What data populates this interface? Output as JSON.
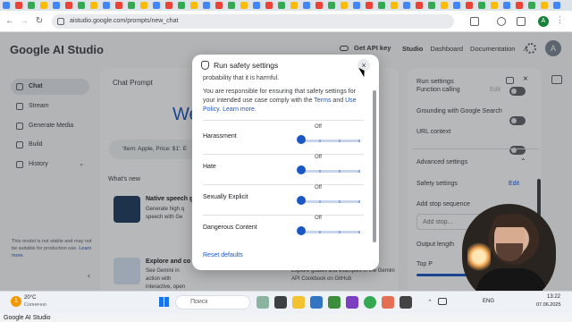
{
  "browser": {
    "url": "aistudio.google.com/prompts/new_chat",
    "avatar_letter": "A"
  },
  "app": {
    "brand": "Google AI Studio",
    "get_api_key": "Get API key",
    "top_nav": [
      "Studio",
      "Dashboard",
      "Documentation"
    ],
    "user_initial": "A"
  },
  "sidebar": {
    "items": [
      {
        "label": "Chat",
        "icon": "chat-icon"
      },
      {
        "label": "Stream",
        "icon": "stream-icon"
      },
      {
        "label": "Generate Media",
        "icon": "media-icon"
      },
      {
        "label": "Build",
        "icon": "build-icon"
      },
      {
        "label": "History",
        "icon": "history-icon"
      }
    ],
    "disclaimer": "This model is not stable and may not be suitable for production use.",
    "learn_more": "Learn more."
  },
  "main": {
    "title": "Chat Prompt",
    "welcome_partial": "We",
    "prompt_partial": "'Item: Apple, Price: $1'. E",
    "whats_new": "What's new",
    "cards": [
      {
        "title": "Native speech g",
        "desc": "Generate high q speech with Ge"
      },
      {
        "title": "Explore and co",
        "desc": "See Gemini in action with interactive, open source examples"
      }
    ],
    "right_card_desc": "Explore guides and examples in the Gemini API Cookbook on GitHub"
  },
  "run_settings": {
    "title": "Run settings",
    "function_calling": "Function calling",
    "function_edit": "Edit",
    "grounding": "Grounding with Google Search",
    "url_context": "URL context",
    "advanced": "Advanced settings",
    "safety": "Safety settings",
    "safety_edit": "Edit",
    "stop_sequence": "Add stop sequence",
    "stop_placeholder": "Add stop...",
    "output_length": "Output length",
    "top_p": "Top P"
  },
  "dialog": {
    "title": "Run safety settings",
    "intro_tail": "probability that it is harmful.",
    "body_text": "You are responsible for ensuring that safety settings for your intended use case comply with the",
    "terms": "Terms",
    "and": "and",
    "usage_policy": "Use Policy.",
    "learn_more": "Learn more.",
    "settings": [
      {
        "name": "Harassment",
        "value": "Off",
        "level": 0
      },
      {
        "name": "Hate",
        "value": "Off",
        "level": 0
      },
      {
        "name": "Sexually Explicit",
        "value": "Off",
        "level": 0
      },
      {
        "name": "Dangerous Content",
        "value": "Off",
        "level": 0
      }
    ],
    "reset": "Reset defaults"
  },
  "taskbar": {
    "temperature": "20°C",
    "weather": "Солнечно",
    "search": "Поиск",
    "time": "13:22",
    "date": "07.06.2025",
    "lang": "ENG"
  },
  "caption": "Google AI Studio"
}
